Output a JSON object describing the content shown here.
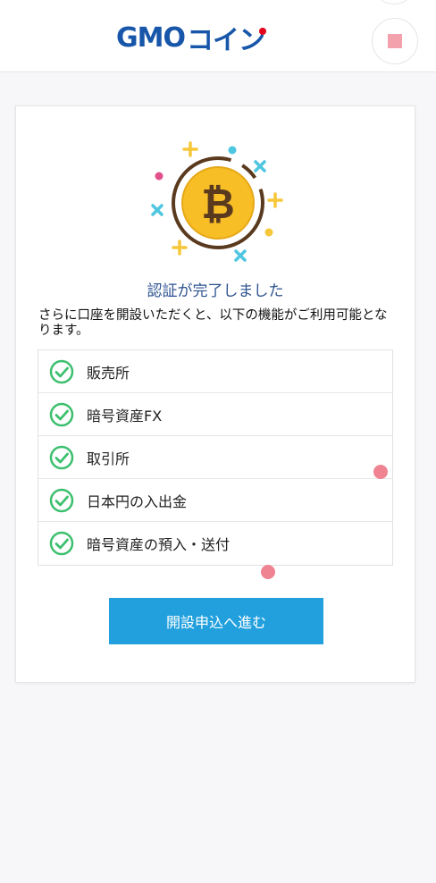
{
  "header": {
    "logo_latin": "GMO",
    "logo_kana": "コイン"
  },
  "card": {
    "title": "認証が完了しました",
    "description": "さらに口座を開設いただくと、以下の機能がご利用可能となります。",
    "features": [
      {
        "label": "販売所"
      },
      {
        "label": "暗号資産FX"
      },
      {
        "label": "取引所"
      },
      {
        "label": "日本円の入出金"
      },
      {
        "label": "暗号資産の預入・送付"
      }
    ],
    "cta_label": "開設申込へ進む"
  },
  "colors": {
    "brand_blue": "#1756a9",
    "title_blue": "#2e5390",
    "cta_blue": "#21a0dd",
    "check_green": "#3cbf6e",
    "coin_yellow": "#f7be26"
  },
  "icons": {
    "coin": "bitcoin-coin-icon",
    "check": "check-circle-icon"
  }
}
